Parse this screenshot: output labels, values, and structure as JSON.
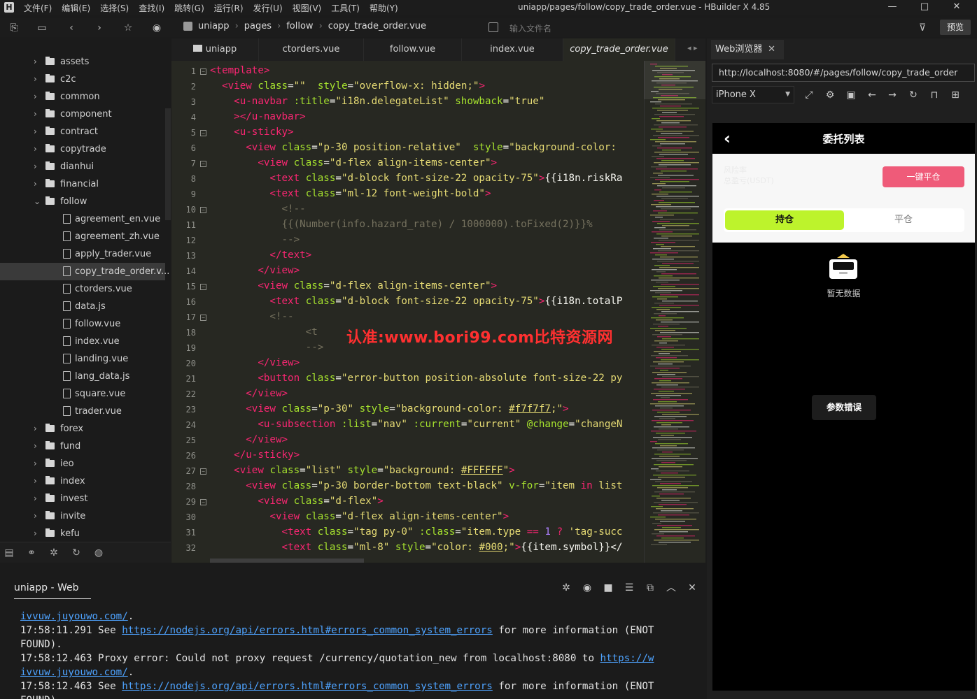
{
  "menubar": {
    "logo": "H",
    "items": [
      "文件(F)",
      "编辑(E)",
      "选择(S)",
      "查找(I)",
      "跳转(G)",
      "运行(R)",
      "发行(U)",
      "视图(V)",
      "工具(T)",
      "帮助(Y)"
    ],
    "title": "uniapp/pages/follow/copy_trade_order.vue - HBuilder X 4.85",
    "controls": [
      "—",
      "□",
      "✕"
    ]
  },
  "toolbar": {
    "breadcrumb": [
      "uniapp",
      "pages",
      "follow",
      "copy_trade_order.vue"
    ],
    "file_search_placeholder": "输入文件名",
    "preview_label": "预览"
  },
  "sidebar": {
    "items": [
      {
        "label": "assets",
        "type": "folder",
        "expanded": false,
        "depth": 0
      },
      {
        "label": "c2c",
        "type": "folder",
        "expanded": false,
        "depth": 0
      },
      {
        "label": "common",
        "type": "folder",
        "expanded": false,
        "depth": 0
      },
      {
        "label": "component",
        "type": "folder",
        "expanded": false,
        "depth": 0
      },
      {
        "label": "contract",
        "type": "folder",
        "expanded": false,
        "depth": 0
      },
      {
        "label": "copytrade",
        "type": "folder",
        "expanded": false,
        "depth": 0
      },
      {
        "label": "dianhui",
        "type": "folder",
        "expanded": false,
        "depth": 0
      },
      {
        "label": "financial",
        "type": "folder",
        "expanded": false,
        "depth": 0
      },
      {
        "label": "follow",
        "type": "folder",
        "expanded": true,
        "depth": 0
      },
      {
        "label": "agreement_en.vue",
        "type": "file",
        "depth": 1
      },
      {
        "label": "agreement_zh.vue",
        "type": "file",
        "depth": 1
      },
      {
        "label": "apply_trader.vue",
        "type": "file",
        "depth": 1
      },
      {
        "label": "copy_trade_order.v...",
        "type": "file",
        "depth": 1,
        "selected": true
      },
      {
        "label": "ctorders.vue",
        "type": "file",
        "depth": 1
      },
      {
        "label": "data.js",
        "type": "file",
        "depth": 1
      },
      {
        "label": "follow.vue",
        "type": "file",
        "depth": 1
      },
      {
        "label": "index.vue",
        "type": "file",
        "depth": 1
      },
      {
        "label": "landing.vue",
        "type": "file",
        "depth": 1
      },
      {
        "label": "lang_data.js",
        "type": "file",
        "depth": 1
      },
      {
        "label": "square.vue",
        "type": "file",
        "depth": 1
      },
      {
        "label": "trader.vue",
        "type": "file",
        "depth": 1
      },
      {
        "label": "forex",
        "type": "folder",
        "expanded": false,
        "depth": 0
      },
      {
        "label": "fund",
        "type": "folder",
        "expanded": false,
        "depth": 0
      },
      {
        "label": "ieo",
        "type": "folder",
        "expanded": false,
        "depth": 0
      },
      {
        "label": "index",
        "type": "folder",
        "expanded": false,
        "depth": 0
      },
      {
        "label": "invest",
        "type": "folder",
        "expanded": false,
        "depth": 0
      },
      {
        "label": "invite",
        "type": "folder",
        "expanded": false,
        "depth": 0
      },
      {
        "label": "kefu",
        "type": "folder",
        "expanded": false,
        "depth": 0
      }
    ],
    "tool_icons": [
      "project-icon",
      "debug-icon",
      "bug-icon",
      "git-icon",
      "web-icon"
    ]
  },
  "tabs": [
    {
      "label": "uniapp",
      "active": false
    },
    {
      "label": "ctorders.vue",
      "active": false
    },
    {
      "label": "follow.vue",
      "active": false
    },
    {
      "label": "index.vue",
      "active": false
    },
    {
      "label": "copy_trade_order.vue",
      "active": true
    }
  ],
  "editor": {
    "lines": [
      {
        "n": "1",
        "fold": "−",
        "html": "<span class=\"t\">&lt;template&gt;</span>"
      },
      {
        "n": "2",
        "fold": "",
        "html": "  <span class=\"t\">&lt;view</span> <span class=\"a\">class</span>=<span class=\"s\">\"\"</span>  <span class=\"a\">style</span>=<span class=\"s\">\"overflow-x: hidden;\"</span><span class=\"t\">&gt;</span>"
      },
      {
        "n": "3",
        "fold": "",
        "html": "    <span class=\"t\">&lt;u-navbar</span> <span class=\"a\">:title</span>=<span class=\"s\">\"i18n.delegateList\"</span> <span class=\"a\">showback</span>=<span class=\"s\">\"true\"</span>"
      },
      {
        "n": "4",
        "fold": "",
        "html": "    <span class=\"t\">&gt;&lt;/u-navbar&gt;</span>"
      },
      {
        "n": "5",
        "fold": "−",
        "html": "    <span class=\"t\">&lt;u-sticky&gt;</span>"
      },
      {
        "n": "6",
        "fold": "",
        "html": "      <span class=\"t\">&lt;view</span> <span class=\"a\">class</span>=<span class=\"s\">\"p-30 position-relative\"</span>  <span class=\"a\">style</span>=<span class=\"s\">\"background-color:</span>"
      },
      {
        "n": "7",
        "fold": "−",
        "html": "        <span class=\"t\">&lt;view</span> <span class=\"a\">class</span>=<span class=\"s\">\"d-flex align-items-center\"</span><span class=\"t\">&gt;</span>"
      },
      {
        "n": "8",
        "fold": "",
        "html": "          <span class=\"t\">&lt;text</span> <span class=\"a\">class</span>=<span class=\"s\">\"d-block font-size-22 opacity-75\"</span><span class=\"t\">&gt;</span>{{i18n.riskRa"
      },
      {
        "n": "9",
        "fold": "",
        "html": "          <span class=\"t\">&lt;text</span> <span class=\"a\">class</span>=<span class=\"s\">\"ml-12 font-weight-bold\"</span><span class=\"t\">&gt;</span>"
      },
      {
        "n": "10",
        "fold": "−",
        "html": "            <span class=\"c\">&lt;!--</span>"
      },
      {
        "n": "11",
        "fold": "",
        "html": "            <span class=\"c\">{{(Number(info.hazard_rate) / 1000000).toFixed(2)}}%</span>"
      },
      {
        "n": "12",
        "fold": "",
        "html": "            <span class=\"c\">--&gt;</span>"
      },
      {
        "n": "13",
        "fold": "",
        "html": "          <span class=\"t\">&lt;/text&gt;</span>"
      },
      {
        "n": "14",
        "fold": "",
        "html": "        <span class=\"t\">&lt;/view&gt;</span>"
      },
      {
        "n": "15",
        "fold": "−",
        "html": "        <span class=\"t\">&lt;view</span> <span class=\"a\">class</span>=<span class=\"s\">\"d-flex align-items-center\"</span><span class=\"t\">&gt;</span>"
      },
      {
        "n": "16",
        "fold": "",
        "html": "          <span class=\"t\">&lt;text</span> <span class=\"a\">class</span>=<span class=\"s\">\"d-block font-size-22 opacity-75\"</span><span class=\"t\">&gt;</span>{{i18n.totalP"
      },
      {
        "n": "17",
        "fold": "−",
        "html": "          <span class=\"c\">&lt;!--</span>"
      },
      {
        "n": "18",
        "fold": "",
        "html": "                <span class=\"c\">&lt;t</span>"
      },
      {
        "n": "19",
        "fold": "",
        "html": "                <span class=\"c\">--&gt;</span>"
      },
      {
        "n": "20",
        "fold": "",
        "html": "        <span class=\"t\">&lt;/view&gt;</span>"
      },
      {
        "n": "21",
        "fold": "",
        "html": "        <span class=\"t\">&lt;button</span> <span class=\"a\">class</span>=<span class=\"s\">\"error-button position-absolute font-size-22 py</span>"
      },
      {
        "n": "22",
        "fold": "",
        "html": "      <span class=\"t\">&lt;/view&gt;</span>"
      },
      {
        "n": "23",
        "fold": "",
        "html": "      <span class=\"t\">&lt;view</span> <span class=\"a\">class</span>=<span class=\"s\">\"p-30\"</span> <span class=\"a\">style</span>=<span class=\"s\">\"background-color: <span class=\"u\">#f7f7f7</span>;\"</span><span class=\"t\">&gt;</span>"
      },
      {
        "n": "24",
        "fold": "",
        "html": "        <span class=\"t\">&lt;u-subsection</span> <span class=\"a\">:list</span>=<span class=\"s\">\"nav\"</span> <span class=\"a\">:current</span>=<span class=\"s\">\"current\"</span> <span class=\"a\">@change</span>=<span class=\"s\">\"changeN</span>"
      },
      {
        "n": "25",
        "fold": "",
        "html": "      <span class=\"t\">&lt;/view&gt;</span>"
      },
      {
        "n": "26",
        "fold": "",
        "html": "    <span class=\"t\">&lt;/u-sticky&gt;</span>"
      },
      {
        "n": "27",
        "fold": "−",
        "html": "    <span class=\"t\">&lt;view</span> <span class=\"a\">class</span>=<span class=\"s\">\"list\"</span> <span class=\"a\">style</span>=<span class=\"s\">\"background: <span class=\"u\">#FFFFFF</span>\"</span><span class=\"t\">&gt;</span>"
      },
      {
        "n": "28",
        "fold": "",
        "html": "      <span class=\"t\">&lt;view</span> <span class=\"a\">class</span>=<span class=\"s\">\"p-30 border-bottom text-black\"</span> <span class=\"a\">v-for</span>=<span class=\"s\">\"item <span class=\"k\">in</span> list</span>"
      },
      {
        "n": "29",
        "fold": "−",
        "html": "        <span class=\"t\">&lt;view</span> <span class=\"a\">class</span>=<span class=\"s\">\"d-flex\"</span><span class=\"t\">&gt;</span>"
      },
      {
        "n": "30",
        "fold": "",
        "html": "          <span class=\"t\">&lt;view</span> <span class=\"a\">class</span>=<span class=\"s\">\"d-flex align-items-center\"</span><span class=\"t\">&gt;</span>"
      },
      {
        "n": "31",
        "fold": "",
        "html": "            <span class=\"t\">&lt;text</span> <span class=\"a\">class</span>=<span class=\"s\">\"tag py-0\"</span> <span class=\"a\">:class</span>=<span class=\"s\">\"item.type <span class=\"k\">==</span> <span class=\"n\">1</span> <span class=\"k\">?</span> 'tag-succ</span>"
      },
      {
        "n": "32",
        "fold": "",
        "html": "            <span class=\"t\">&lt;text</span> <span class=\"a\">class</span>=<span class=\"s\">\"ml-8\"</span> <span class=\"a\">style</span>=<span class=\"s\">\"color: <span class=\"u\">#000</span>;\"</span><span class=\"t\">&gt;</span>{{item.symbol}}&lt;/"
      }
    ],
    "watermark": "认准:www.bori99.com比特资源网"
  },
  "browser": {
    "tab_label": "Web浏览器",
    "url": "http://localhost:8080/#/pages/follow/copy_trade_order",
    "device": "iPhone X",
    "phone": {
      "title": "委托列表",
      "risk_line1": "风险率",
      "risk_line2": "总盈亏(USDT)",
      "close_all_button": "一键平仓",
      "segment_hold": "持仓",
      "segment_close": "平仓",
      "empty_text": "暂无数据",
      "toast": "参数错误"
    }
  },
  "console": {
    "tab_label": "uniapp - Web",
    "lines": [
      [
        {
          "t": "ivvuw.juyouwo.com/",
          "link": true
        },
        {
          "t": ".",
          "link": false
        }
      ],
      [
        {
          "t": "17:58:11.291 See ",
          "link": false
        },
        {
          "t": "https://nodejs.org/api/errors.html#errors_common_system_errors",
          "link": true
        },
        {
          "t": " for more information (ENOT",
          "link": false
        }
      ],
      [
        {
          "t": "FOUND).",
          "link": false
        }
      ],
      [
        {
          "t": "17:58:12.463 Proxy error: Could not proxy request /currency/quotation_new from localhost:8080 to ",
          "link": false
        },
        {
          "t": "https://w",
          "link": true
        }
      ],
      [
        {
          "t": "ivvuw.juyouwo.com/",
          "link": true
        },
        {
          "t": ".",
          "link": false
        }
      ],
      [
        {
          "t": "17:58:12.463 See ",
          "link": false
        },
        {
          "t": "https://nodejs.org/api/errors.html#errors_common_system_errors",
          "link": true
        },
        {
          "t": " for more information (ENOT",
          "link": false
        }
      ],
      [
        {
          "t": "FOUND).",
          "link": false
        }
      ]
    ]
  }
}
